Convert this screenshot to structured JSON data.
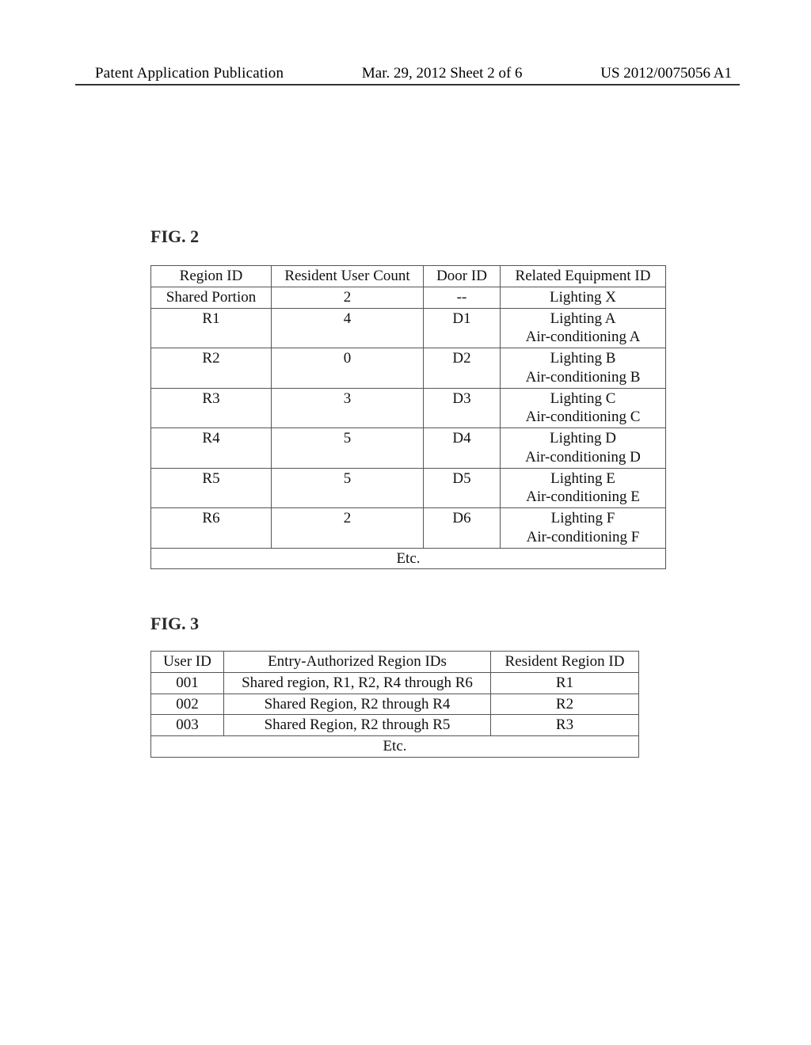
{
  "header": {
    "left": "Patent Application Publication",
    "middle": "Mar. 29, 2012  Sheet 2 of 6",
    "right": "US 2012/0075056 A1"
  },
  "fig2": {
    "label": "FIG. 2",
    "headers": {
      "region": "Region ID",
      "count": "Resident User Count",
      "door": "Door ID",
      "equip": "Related Equipment ID"
    },
    "rows": [
      {
        "region": "Shared Portion",
        "count": "2",
        "door": "--",
        "equip": "Lighting X"
      },
      {
        "region": "R1",
        "count": "4",
        "door": "D1",
        "equip": "Lighting A\nAir-conditioning A"
      },
      {
        "region": "R2",
        "count": "0",
        "door": "D2",
        "equip": "Lighting B\nAir-conditioning B"
      },
      {
        "region": "R3",
        "count": "3",
        "door": "D3",
        "equip": "Lighting C\nAir-conditioning C"
      },
      {
        "region": "R4",
        "count": "5",
        "door": "D4",
        "equip": "Lighting D\nAir-conditioning D"
      },
      {
        "region": "R5",
        "count": "5",
        "door": "D5",
        "equip": "Lighting E\nAir-conditioning E"
      },
      {
        "region": "R6",
        "count": "2",
        "door": "D6",
        "equip": "Lighting F\nAir-conditioning F"
      }
    ],
    "etc": "Etc."
  },
  "fig3": {
    "label": "FIG. 3",
    "headers": {
      "uid": "User ID",
      "auth": "Entry-Authorized Region IDs",
      "res": "Resident Region ID"
    },
    "rows": [
      {
        "uid": "001",
        "auth": "Shared region, R1, R2, R4 through R6",
        "res": "R1"
      },
      {
        "uid": "002",
        "auth": "Shared Region, R2 through R4",
        "res": "R2"
      },
      {
        "uid": "003",
        "auth": "Shared Region, R2 through R5",
        "res": "R3"
      }
    ],
    "etc": "Etc."
  }
}
